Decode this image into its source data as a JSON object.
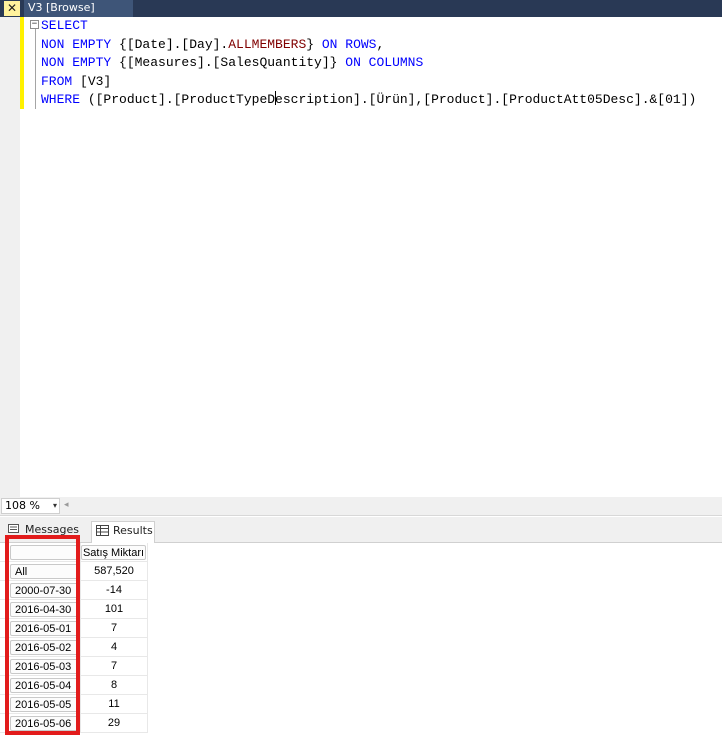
{
  "tab": {
    "title": "V3 [Browse]",
    "close_glyph": "✕"
  },
  "editor": {
    "collapse_glyph": "−",
    "lines": [
      [
        {
          "t": "SELECT",
          "c": "kw"
        }
      ],
      [
        {
          "t": "NON EMPTY ",
          "c": "kw"
        },
        {
          "t": "{[Date].[Day].",
          "c": ""
        },
        {
          "t": "ALLMEMBERS",
          "c": "fn"
        },
        {
          "t": "} ",
          "c": ""
        },
        {
          "t": "ON ROWS",
          "c": "kw"
        },
        {
          "t": ",",
          "c": ""
        }
      ],
      [
        {
          "t": "NON EMPTY ",
          "c": "kw"
        },
        {
          "t": "{[Measures].[SalesQuantity]} ",
          "c": ""
        },
        {
          "t": "ON COLUMNS",
          "c": "kw"
        }
      ],
      [
        {
          "t": "FROM ",
          "c": "kw"
        },
        {
          "t": "[V3]",
          "c": ""
        }
      ],
      [
        {
          "t": "WHERE ",
          "c": "kw"
        },
        {
          "t": "([Product].[ProductTypeD",
          "c": ""
        },
        {
          "t": "",
          "c": "caret"
        },
        {
          "t": "escription].[Ürün],[Product].[ProductAtt05Desc].&[01])",
          "c": ""
        }
      ]
    ]
  },
  "zoom": {
    "value": "108 %",
    "arrow": "▾",
    "scroll_left": "◂"
  },
  "results_tabs": {
    "messages": "Messages",
    "results": "Results"
  },
  "grid": {
    "column_header": "Satış Miktarı",
    "rows": [
      {
        "label": "All",
        "value": "587,520"
      },
      {
        "label": "2000-07-30",
        "value": "-14"
      },
      {
        "label": "2016-04-30",
        "value": "101"
      },
      {
        "label": "2016-05-01",
        "value": "7"
      },
      {
        "label": "2016-05-02",
        "value": "4"
      },
      {
        "label": "2016-05-03",
        "value": "7"
      },
      {
        "label": "2016-05-04",
        "value": "8"
      },
      {
        "label": "2016-05-05",
        "value": "11"
      },
      {
        "label": "2016-05-06",
        "value": "29"
      }
    ]
  },
  "colors": {
    "highlight_box": "#e21b1b",
    "keyword": "#0000ff",
    "function": "#800000",
    "tab_bg": "#293955"
  }
}
